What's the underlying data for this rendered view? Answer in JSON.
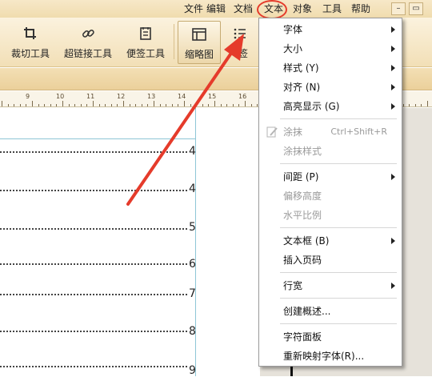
{
  "menubar": {
    "items": [
      "文件",
      "编辑",
      "文档",
      "文本",
      "对象",
      "工具",
      "帮助"
    ],
    "active": "文本",
    "minimize_label": "–",
    "maximize_label": "▭"
  },
  "toolbar": {
    "crop_label": "裁切工具",
    "hyperlink_label": "超链接工具",
    "note_label": "便签工具",
    "thumbnail_label": "缩略图",
    "bookmark_label": "签"
  },
  "ruler": {
    "numbers": [
      "9",
      "10",
      "11",
      "12",
      "13",
      "14",
      "15",
      "16"
    ]
  },
  "page": {
    "line_numbers": [
      "4",
      "4",
      "5",
      "6",
      "7",
      "8",
      "9"
    ]
  },
  "dropdown": {
    "items": [
      {
        "label": "字体",
        "submenu": true
      },
      {
        "label": "大小",
        "submenu": true
      },
      {
        "label": "样式 (Y)",
        "submenu": true
      },
      {
        "label": "对齐 (N)",
        "submenu": true
      },
      {
        "label": "高亮显示 (G)",
        "submenu": true
      },
      {
        "label": "涂抹",
        "shortcut": "Ctrl+Shift+R",
        "disabled": true
      },
      {
        "label": "涂抹样式",
        "disabled": true
      },
      {
        "label": "间距 (P)",
        "submenu": true
      },
      {
        "label": "偏移高度",
        "disabled": true
      },
      {
        "label": "水平比例",
        "disabled": true
      },
      {
        "label": "文本框 (B)",
        "submenu": true
      },
      {
        "label": "插入页码"
      },
      {
        "label": "行宽",
        "submenu": true
      },
      {
        "label": "创建概述..."
      },
      {
        "label": "字符面板"
      },
      {
        "label": "重新映射字体(R)..."
      }
    ]
  },
  "colors": {
    "annotation_red": "#e53b2b",
    "toolbar_tan": "#f2dfb6"
  }
}
